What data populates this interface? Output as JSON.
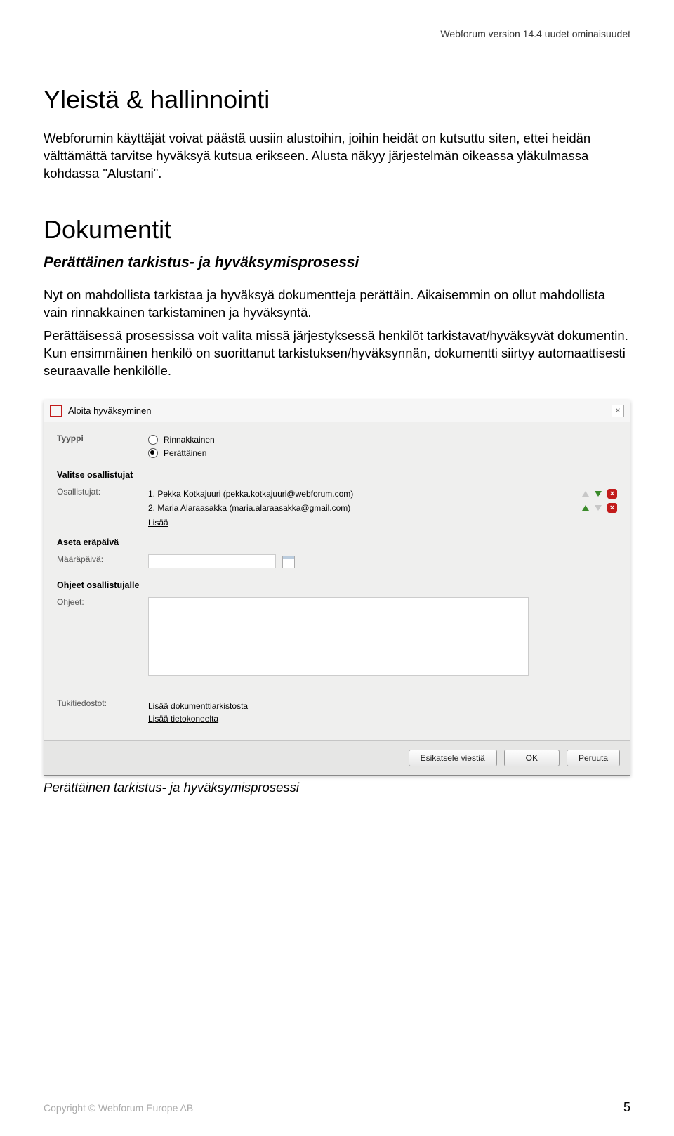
{
  "header": {
    "running": "Webforum version 14.4 uudet ominaisuudet"
  },
  "s1": {
    "title": "Yleistä & hallinnointi",
    "p1": "Webforumin käyttäjät voivat päästä uusiin alustoihin, joihin heidät on kutsuttu siten, ettei heidän välttämättä tarvitse hyväksyä kutsua erikseen. Alusta näkyy järjestelmän oikeassa yläkulmassa kohdassa \"Alustani\"."
  },
  "s2": {
    "title": "Dokumentit",
    "subhead": "Perättäinen tarkistus- ja hyväksymisprosessi",
    "p1": "Nyt on mahdollista tarkistaa ja hyväksyä dokumentteja perättäin. Aikaisemmin on ollut mahdollista vain rinnakkainen tarkistaminen ja hyväksyntä.",
    "p2": "Perättäisessä prosessissa voit valita missä järjestyksessä henkilöt tarkistavat/hyväksyvät dokumentin. Kun ensimmäinen henkilö on suorittanut tarkistuksen/hyväksynnän, dokumentti siirtyy automaattisesti seuraavalle henkilölle."
  },
  "dlg": {
    "title": "Aloita hyväksyminen",
    "type_label": "Tyyppi",
    "type_opts": {
      "par": "Rinnakkainen",
      "seq": "Perättäinen"
    },
    "sel_participants": "Valitse osallistujat",
    "participants_label": "Osallistujat:",
    "participants": [
      {
        "n": "1. Pekka Kotkajuuri (pekka.kotkajuuri@webforum.com)"
      },
      {
        "n": "2. Maria Alaraasakka (maria.alaraasakka@gmail.com)"
      }
    ],
    "add": "Lisää",
    "due_section": "Aseta eräpäivä",
    "due_label": "Määräpäivä:",
    "instr_section": "Ohjeet osallistujalle",
    "instr_label": "Ohjeet:",
    "support_label": "Tukitiedostot:",
    "support_links": {
      "a": "Lisää dokumenttiarkistosta",
      "b": "Lisää tietokoneelta"
    },
    "buttons": {
      "preview": "Esikatsele viestiä",
      "ok": "OK",
      "cancel": "Peruuta"
    }
  },
  "caption": "Perättäinen tarkistus- ja hyväksymisprosessi",
  "footer": {
    "copyright": "Copyright © Webforum Europe AB",
    "page": "5"
  }
}
